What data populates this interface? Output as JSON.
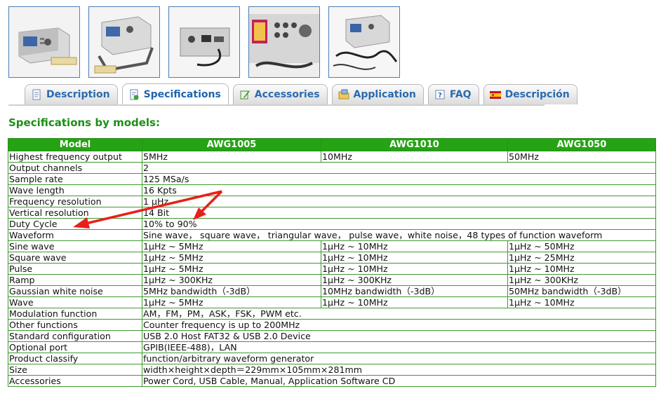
{
  "tabs": [
    {
      "label": "Description",
      "active": false,
      "icon": "document-icon"
    },
    {
      "label": "Specifications",
      "active": true,
      "icon": "document-check-icon"
    },
    {
      "label": "Accessories",
      "active": false,
      "icon": "pencil-icon"
    },
    {
      "label": "Application",
      "active": false,
      "icon": "folder-icon"
    },
    {
      "label": "FAQ",
      "active": false,
      "icon": "help-icon"
    },
    {
      "label": "Descripción",
      "active": false,
      "icon": "spain-flag-icon"
    }
  ],
  "section_title": "Specifications by models:",
  "table": {
    "headers": [
      "Model",
      "AWG1005",
      "AWG1010",
      "AWG1050"
    ],
    "rows": [
      {
        "label": "Highest frequency output",
        "cells": [
          "5MHz",
          "10MHz",
          "50MHz"
        ]
      },
      {
        "label": "Output channels",
        "value": "2"
      },
      {
        "label": "Sample rate",
        "value": "125 MSa/s"
      },
      {
        "label": "Wave length",
        "value": "16 Kpts"
      },
      {
        "label": "Frequency resolution",
        "value": "1 μHz"
      },
      {
        "label": "Vertical resolution",
        "value": "14 Bit"
      },
      {
        "label": "Duty Cycle",
        "value": "10% to 90%"
      },
      {
        "label": "Waveform",
        "value": "Sine wave， square wave， triangular wave， pulse wave，white noise，48 types of function waveform"
      },
      {
        "label": "Sine wave",
        "cells": [
          "1μHz ~ 5MHz",
          "1μHz ~ 10MHz",
          "1μHz ~ 50MHz"
        ]
      },
      {
        "label": "Square wave",
        "cells": [
          "1μHz ~ 5MHz",
          "1μHz ~ 10MHz",
          "1μHz ~ 25MHz"
        ]
      },
      {
        "label": "Pulse",
        "cells": [
          "1μHz ~ 5MHz",
          "1μHz ~ 10MHz",
          "1μHz ~ 10MHz"
        ]
      },
      {
        "label": "Ramp",
        "cells": [
          "1μHz ~ 300KHz",
          "1μHz ~ 300KHz",
          "1μHz ~ 300KHz"
        ]
      },
      {
        "label": "Gaussian white noise",
        "cells": [
          "5MHz bandwidth（-3dB）",
          "10MHz bandwidth（-3dB）",
          "50MHz bandwidth（-3dB）"
        ]
      },
      {
        "label": "Wave",
        "cells": [
          "1μHz ~ 5MHz",
          "1μHz ~ 10MHz",
          "1μHz ~ 10MHz"
        ]
      },
      {
        "label": "Modulation function",
        "value": "AM，FM，PM，ASK，FSK，PWM etc."
      },
      {
        "label": "Other functions",
        "value": "Counter frequency is up to 200MHz"
      },
      {
        "label": "Standard configuration",
        "value": "USB 2.0 Host FAT32 & USB 2.0 Device"
      },
      {
        "label": "Optional port",
        "value": "GPIB(IEEE-488)，LAN"
      },
      {
        "label": "Product classify",
        "value": "function/arbitrary waveform generator"
      },
      {
        "label": "Size",
        "value": "width×height×depth＝229mm×105mm×281mm"
      },
      {
        "label": "Accessories",
        "value": "Power Cord, USB Cable, Manual, Application Software CD"
      }
    ]
  },
  "colors": {
    "header_green": "#24a313",
    "title_green": "#1b8f17",
    "border_green": "#3d9a2d",
    "tab_text_blue": "#2a6bb0",
    "thumb_border": "#4a7fb5",
    "arrow_red": "#e8201a"
  }
}
